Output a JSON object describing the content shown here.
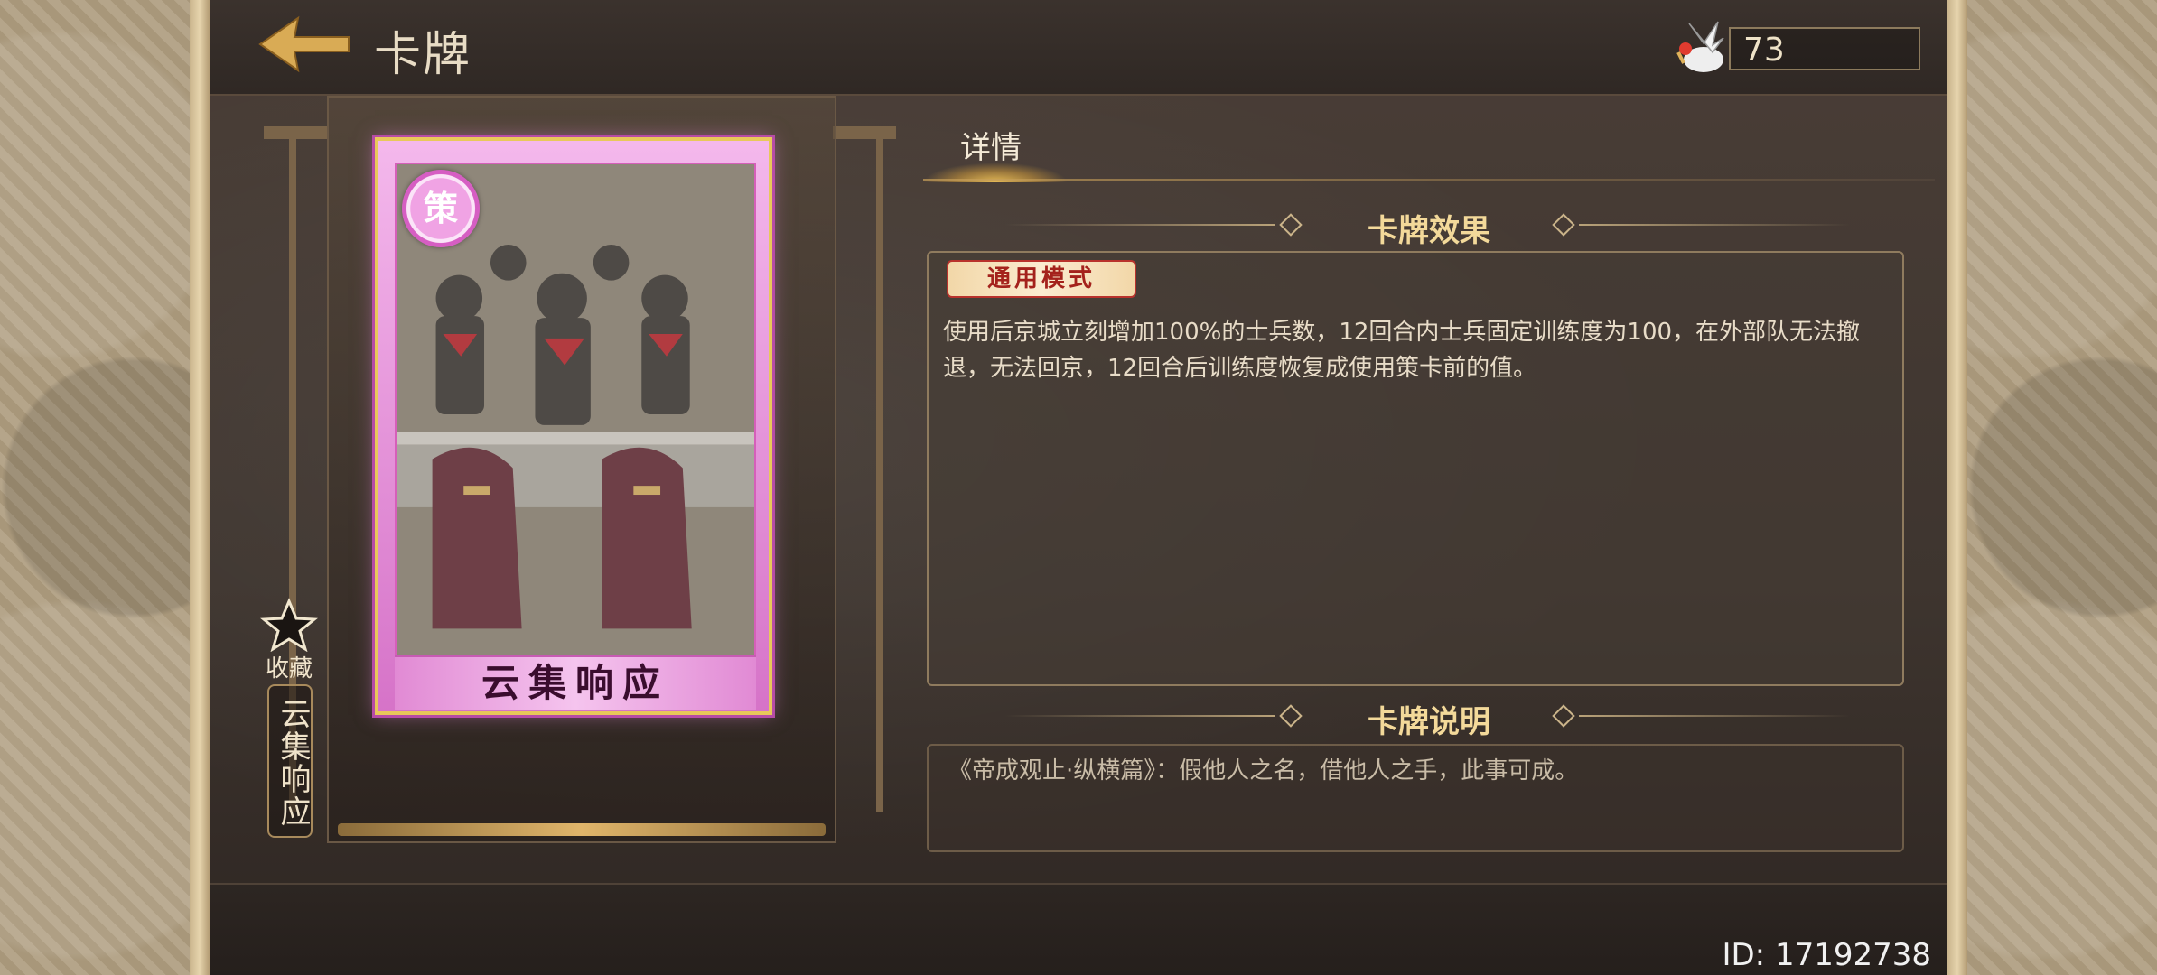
{
  "header": {
    "title": "卡牌",
    "currency_value": "73"
  },
  "card": {
    "badge": "策",
    "name": "云集响应",
    "collect_label": "收藏",
    "vertical_name": "云集响应"
  },
  "tabs": {
    "detail": "详情"
  },
  "effect": {
    "section_title": "卡牌效果",
    "mode_label": "通用模式",
    "text": "使用后京城立刻增加100%的士兵数，12回合内士兵固定训练度为100，在外部队无法撤退，无法回京，12回合后训练度恢复成使用策卡前的值。"
  },
  "description": {
    "section_title": "卡牌说明",
    "text": "《帝成观止·纵横篇》：假他人之名，借他人之手，此事可成。"
  },
  "footer": {
    "id_text": "ID: 17192738"
  }
}
